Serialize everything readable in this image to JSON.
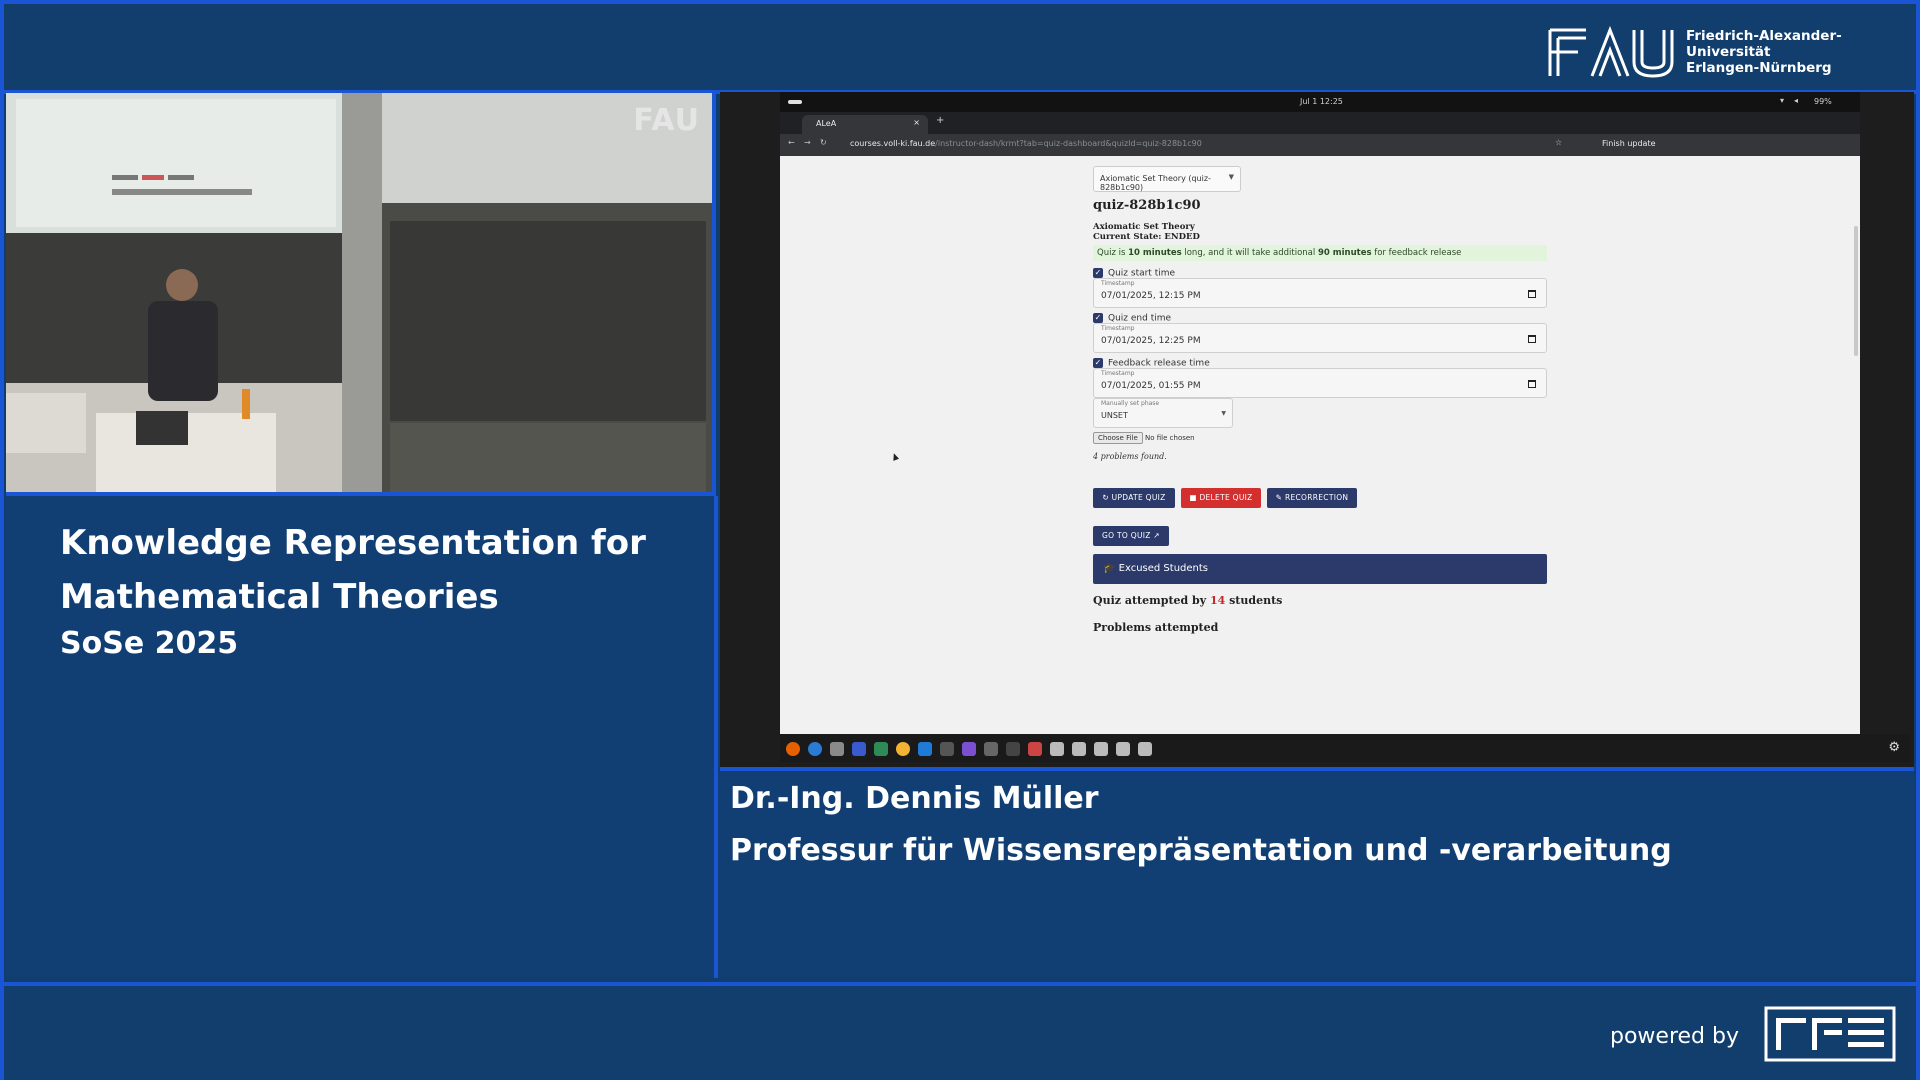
{
  "header": {
    "university_line1": "Friedrich-Alexander-Universität",
    "university_line2": "Erlangen-Nürnberg"
  },
  "camera": {
    "watermark": "FAU"
  },
  "course": {
    "title": "Knowledge Representation for Mathematical Theories",
    "semester": "SoSe 2025"
  },
  "lecturer": {
    "name": "Dr.-Ing. Dennis Müller",
    "chair": "Professur für Wissensrepräsentation und -verarbeitung"
  },
  "footer": {
    "powered_by": "powered by"
  },
  "desktop": {
    "clock": "Jul 1  12:25",
    "battery": "99%"
  },
  "browser": {
    "tab_title": "ALeA",
    "url_domain": "courses.voll-ki.fau.de",
    "url_path": "/instructor-dash/krmt?tab=quiz-dashboard&quizId=quiz-828b1c90",
    "finish_update": "Finish update"
  },
  "quiz": {
    "selector": "Axiomatic Set Theory (quiz-828b1c90)",
    "id_heading": "quiz-828b1c90",
    "subtitle": "Axiomatic Set Theory",
    "state": "Current State: ENDED",
    "info_prefix": "Quiz is ",
    "info_minutes": "10 minutes",
    "info_mid": " long, and it will take additional ",
    "info_feedback": "90 minutes",
    "info_suffix": " for feedback release",
    "start_label": "Quiz start time",
    "start_value": "07/01/2025, 12:15 PM",
    "end_label": "Quiz end time",
    "end_value": "07/01/2025, 12:25 PM",
    "feedback_label": "Feedback release time",
    "feedback_value": "07/01/2025, 01:55 PM",
    "timestamp_label": "Timestamp",
    "phase_label": "Manually set phase",
    "phase_value": "UNSET",
    "choose_file": "Choose File",
    "no_file": "No file chosen",
    "problems_found": "4 problems found.",
    "update_btn": "UPDATE QUIZ",
    "delete_btn": "DELETE QUIZ",
    "recorrection_btn": "RECORRECTION",
    "goto_btn": "GO TO QUIZ",
    "excused": "Excused Students",
    "attempted_prefix": "Quiz attempted by ",
    "attempted_count": "14",
    "attempted_suffix": " students",
    "problems_attempted": "Problems attempted"
  },
  "colors": {
    "frame_border": "#1a55d6",
    "panel_blue": "#113f73",
    "update_button": "#2b3a6b",
    "delete_button": "#d32f2f",
    "info_green": "#e3f4dc",
    "attempted_count": "#c62828"
  }
}
